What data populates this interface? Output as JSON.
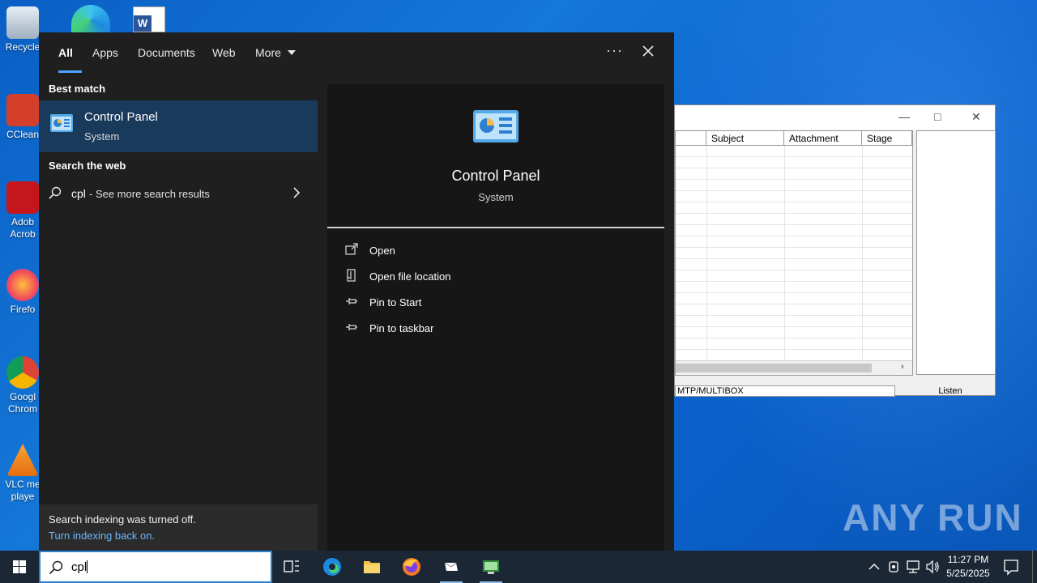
{
  "desktop": {
    "icons": [
      {
        "label": "Recycle",
        "color": "#cfd8e0"
      },
      {
        "label": "CClean",
        "color": "#d33f2a"
      },
      {
        "label": "Adob\nAcrob",
        "color": "#c4161c"
      },
      {
        "label": "Firefo",
        "color": "#f57b20"
      },
      {
        "label": "Googl\nChrom",
        "color": "#2f9a45"
      },
      {
        "label": "VLC me\nplaye",
        "color": "#f28c1a"
      }
    ]
  },
  "background_window": {
    "columns": [
      "Subject",
      "Attachment",
      "Stage"
    ],
    "status_text": "MTP/MULTIBOX",
    "listen_label": "Listen"
  },
  "search": {
    "tabs": [
      "All",
      "Apps",
      "Documents",
      "Web",
      "More"
    ],
    "best_match_title": "Best match",
    "best_match": {
      "name": "Control Panel",
      "type": "System"
    },
    "web_title": "Search the web",
    "web_query": "cpl",
    "web_suffix": " - See more search results",
    "index_note": "Search indexing was turned off.",
    "index_link": "Turn indexing back on.",
    "preview": {
      "name": "Control Panel",
      "type": "System"
    },
    "actions": [
      "Open",
      "Open file location",
      "Pin to Start",
      "Pin to taskbar"
    ]
  },
  "taskbar": {
    "search_value": "cpl",
    "time": "11:27 PM",
    "date": "5/25/2025"
  },
  "watermark": "ANY RUN",
  "colors": {
    "accent": "#4aa3ff",
    "selection": "#1a3a5c",
    "taskbar": "#1c2735"
  }
}
